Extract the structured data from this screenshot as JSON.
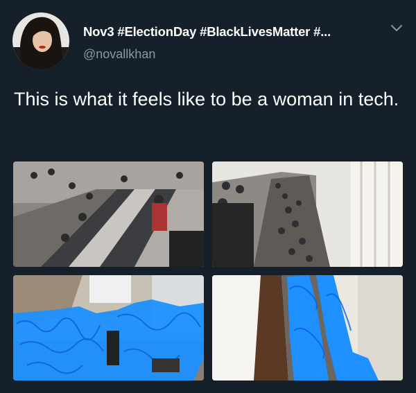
{
  "tweet": {
    "display_name": "Nov3 #ElectionDay #BlackLivesMatter #...",
    "handle": "@novallkhan",
    "text": "This is what it feels like to be a woman in tech."
  },
  "icons": {
    "more": "chevron-down-icon"
  },
  "colors": {
    "background": "#15202b",
    "secondary_text": "#8899a6",
    "scribble": "#1e90ff"
  }
}
